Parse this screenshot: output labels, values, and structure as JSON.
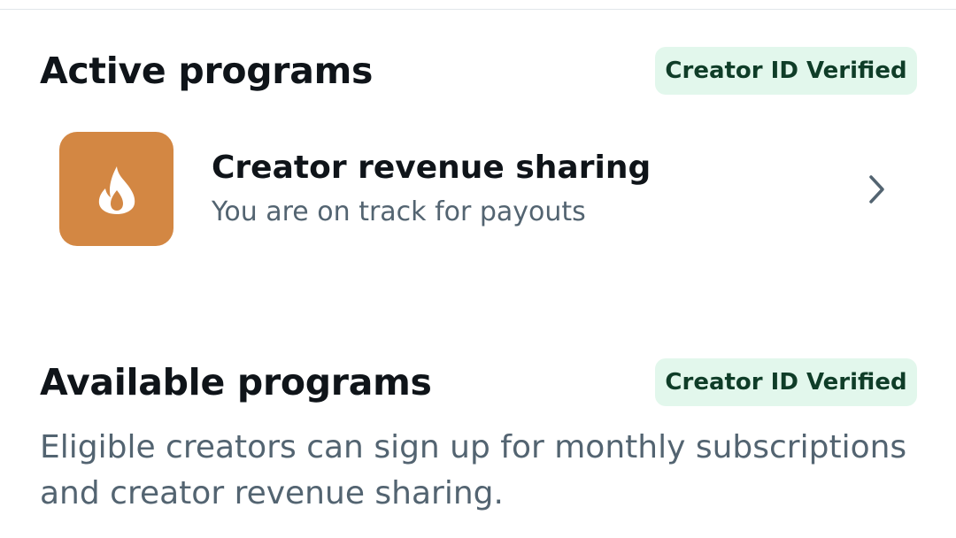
{
  "active_section": {
    "title": "Active programs",
    "badge": "Creator ID Verified",
    "program": {
      "name": "Creator revenue sharing",
      "status": "You are on track for payouts",
      "icon": "flame-icon",
      "icon_bg_color": "#d38743"
    }
  },
  "available_section": {
    "title": "Available programs",
    "badge": "Creator ID Verified",
    "description": "Eligible creators can sign up for monthly subscriptions and creator revenue sharing."
  },
  "colors": {
    "badge_bg": "#e2f7ec",
    "badge_text": "#0f3d28",
    "primary_text": "#0f1419",
    "secondary_text": "#536471"
  }
}
